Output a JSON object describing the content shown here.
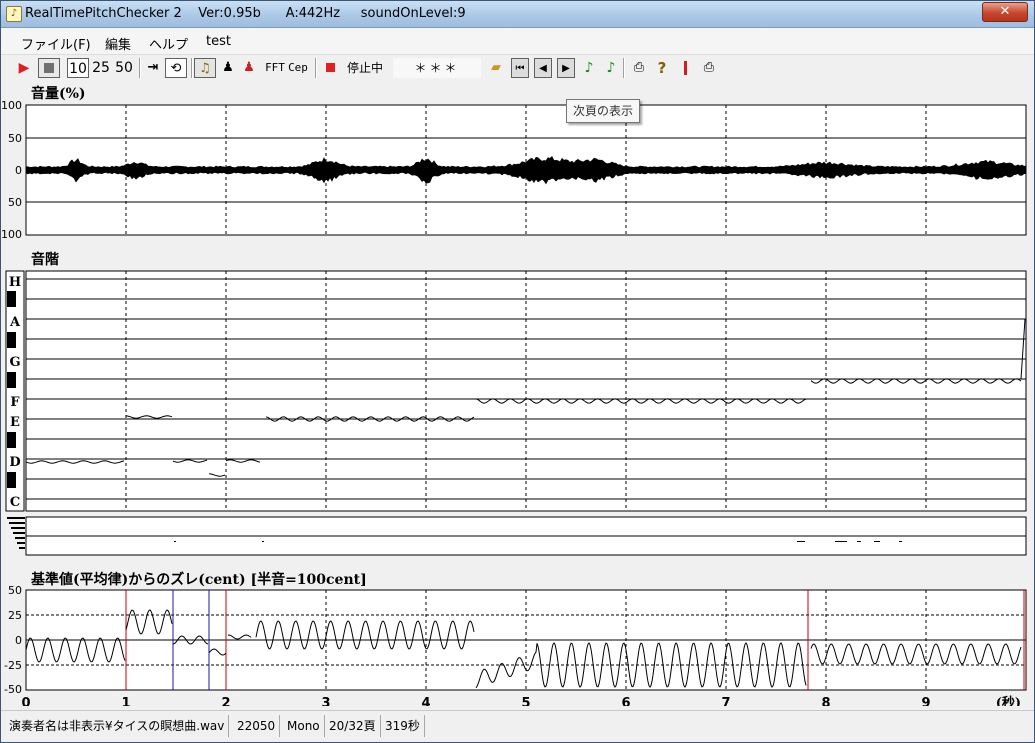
{
  "window": {
    "title": "RealTimePitchChecker 2    Ver:0.95b      A:442Hz     soundOnLevel:9",
    "close_label": "✕",
    "app_icon": "music-note-icon"
  },
  "menu": [
    "ファイル(F)",
    "編集",
    "ヘルプ",
    "test"
  ],
  "toolbar": {
    "n10": "10",
    "n25": "25",
    "n50": "50",
    "fft": "FFT",
    "cep": "Cep",
    "status": "停止中",
    "display": "＊＊＊",
    "icons": [
      "play-icon",
      "stop-icon",
      "step-to-end-icon",
      "loop-icon",
      "violin-icon",
      "person-icon",
      "person-red-icon",
      "record-icon",
      "open-folder-icon",
      "first-page-icon",
      "prev-page-icon",
      "next-page-icon",
      "note-icon",
      "note2-icon",
      "print-icon",
      "help-icon",
      "marker-icon",
      "printer-icon"
    ]
  },
  "tooltip": "次頁の表示",
  "volume_panel": {
    "label": "音量(%)",
    "ticks": [
      "100",
      "50",
      "0",
      "50",
      "100"
    ]
  },
  "scale_panel": {
    "label": "音階",
    "notes": [
      "H",
      "A",
      "G",
      "F",
      "E",
      "D",
      "C"
    ]
  },
  "cent_panel": {
    "label": "基準値(平均律)からのズレ(cent) [半音=100cent]",
    "ticks": [
      "50",
      "25",
      "0",
      "-25",
      "-50"
    ]
  },
  "time_axis": {
    "ticks": [
      "0",
      "1",
      "2",
      "3",
      "4",
      "5",
      "6",
      "7",
      "8",
      "9"
    ],
    "unit": "(秒)"
  },
  "status": [
    "演奏者名は非表示¥タイスの瞑想曲.wav",
    "22050",
    "Mono",
    "20/32頁",
    "319秒"
  ],
  "colors": {
    "play": "#e02020",
    "marker_red": "#cc0000",
    "marker_blue": "#1a1aa0",
    "note_green": "#1a8a1a"
  }
}
